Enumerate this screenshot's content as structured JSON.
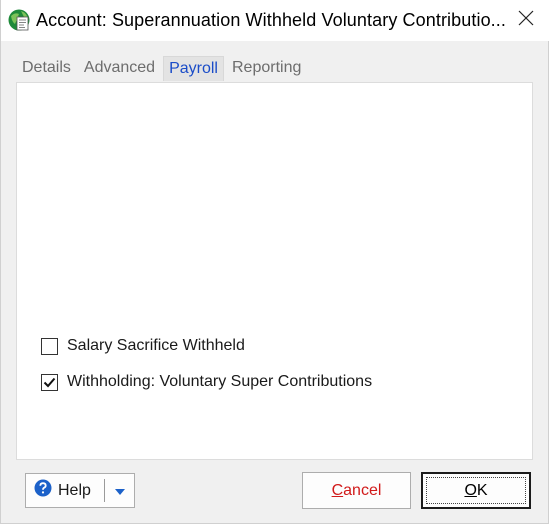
{
  "window": {
    "title": "Account: Superannuation Withheld Voluntary Contributio..."
  },
  "tabs": [
    {
      "label": "Details",
      "active": false
    },
    {
      "label": "Advanced",
      "active": false
    },
    {
      "label": "Payroll",
      "active": true
    },
    {
      "label": "Reporting",
      "active": false
    }
  ],
  "payroll": {
    "checkboxes": [
      {
        "label": "Salary Sacrifice Withheld",
        "checked": false
      },
      {
        "label": "Withholding: Voluntary Super Contributions",
        "checked": true
      }
    ]
  },
  "footer": {
    "help_label": "Help",
    "cancel_label": "Cancel",
    "ok_label": "OK"
  },
  "colors": {
    "active_tab_text": "#1a4cc8",
    "cancel_text": "#d11a1a",
    "help_icon": "#1c61c9"
  },
  "icons": {
    "app": "account-globe-icon",
    "close": "close-icon",
    "help": "help-circle-icon",
    "dropdown": "dropdown-arrow-icon"
  }
}
